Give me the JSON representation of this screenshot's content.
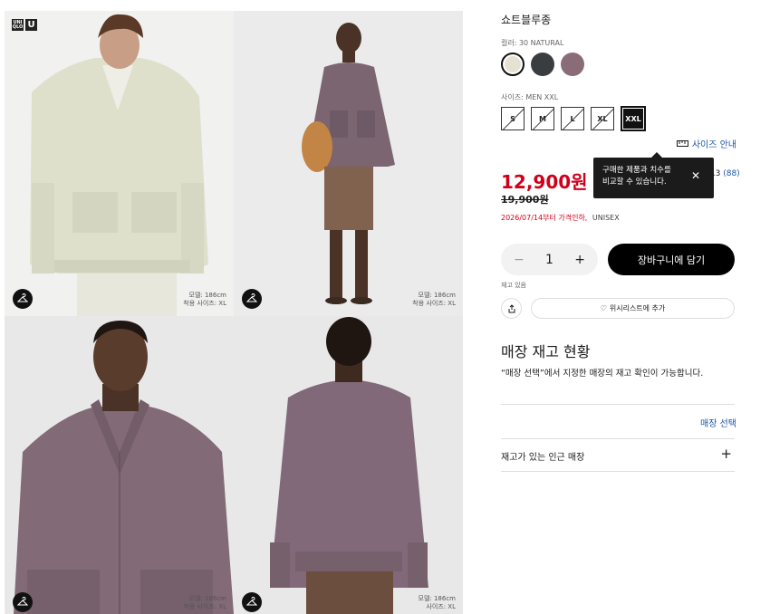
{
  "gallery": {
    "logo": {
      "top": "UNI QLO",
      "bottom": "U"
    },
    "photos": [
      {
        "model_line1": "모델: 186cm",
        "model_line2": "착용 사이즈: XL"
      },
      {
        "model_line1": "모델: 186cm",
        "model_line2": "착용 사이즈: XL"
      },
      {
        "model_line1": "모델: 186cm",
        "model_line2": "착용 사이즈: XL"
      },
      {
        "model_line1": "모델: 186cm",
        "model_line2": "사이즈: XL"
      }
    ],
    "icon": "hanger-icon"
  },
  "product": {
    "title": "쇼트블루종",
    "color_label": "컬러: 30 NATURAL",
    "swatches": [
      {
        "name": "natural",
        "color": "#e6e2d3",
        "selected": true
      },
      {
        "name": "dark-gray",
        "color": "#3a3d40",
        "selected": false
      },
      {
        "name": "purple",
        "color": "#8a6c78",
        "selected": false
      }
    ],
    "size_label": "사이즈: MEN XXL",
    "sizes": [
      "S",
      "M",
      "L",
      "XL",
      "XXL"
    ],
    "selected_size": "XXL",
    "size_guide": "사이즈 안내",
    "tooltip": {
      "line1": "구매한 제품과 치수를",
      "line2": "비교할 수 있습니다."
    },
    "rating": {
      "value": "4.3",
      "count": "(88)"
    },
    "price": "12,900원",
    "original_price": "19,900원",
    "notice_red": "2026/07/14부터 가격인하,",
    "notice_gender": "UNISEX",
    "quantity": "1",
    "qty_minus": "−",
    "qty_plus": "+",
    "add_to_cart": "장바구니에 담기",
    "stock": "재고 있음",
    "wishlist": "위시리스트에 추가"
  },
  "store": {
    "title": "매장 재고 현황",
    "description": "“매장 선택”에서 지정한 매장의 재고 확인이 가능합니다.",
    "select": "매장 선택",
    "nearby": "재고가 있는 인근 매장",
    "plus": "+"
  },
  "colors": {
    "sale_red": "#d0001a",
    "link_blue": "#1a56a6"
  }
}
